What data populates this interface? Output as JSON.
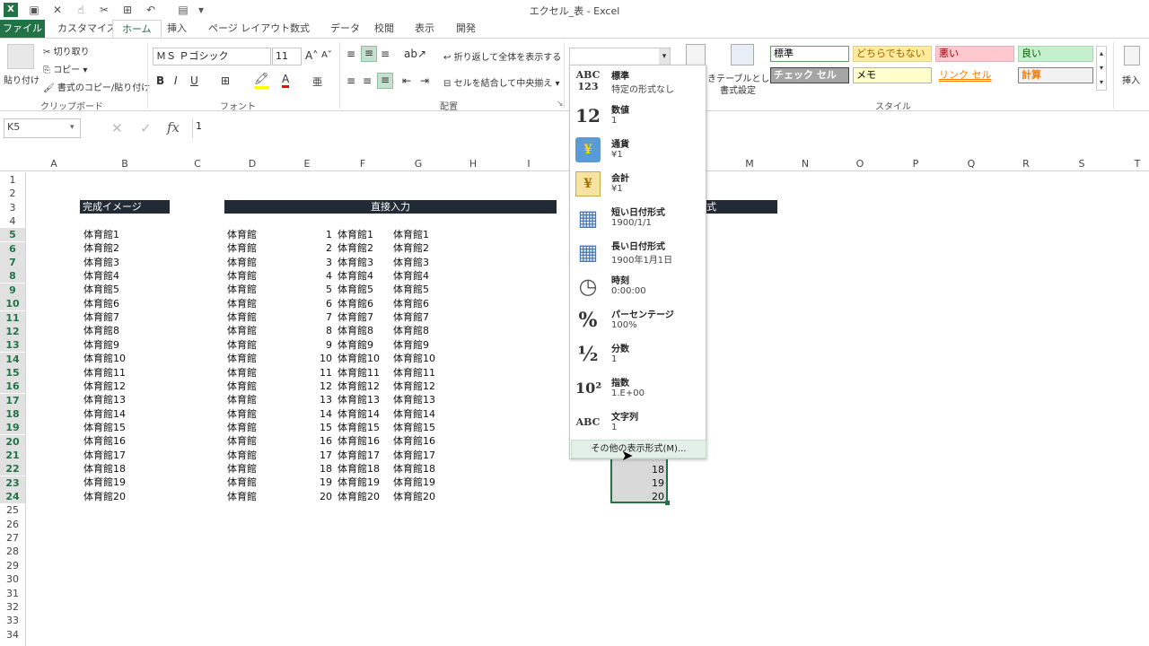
{
  "window": {
    "title": "エクセル_表 - Excel"
  },
  "tabs": [
    "ファイル",
    "カスタマイズ",
    "ホーム",
    "挿入",
    "ページ レイアウト",
    "数式",
    "データ",
    "校閲",
    "表示",
    "開発"
  ],
  "ribbon": {
    "clipboard": {
      "paste": "貼り付け",
      "cut": "切り取り",
      "copy": "コピー",
      "format_painter": "書式のコピー/貼り付け",
      "label": "クリップボード"
    },
    "font": {
      "name": "ＭＳ Ｐゴシック",
      "size": "11",
      "label": "フォント"
    },
    "alignment": {
      "wrap": "折り返して全体を表示する",
      "merge": "セルを結合して中央揃え",
      "label": "配置"
    },
    "number_format_value": "",
    "table_btn": {
      "left": "き",
      "text1": "テーブルとして",
      "text2": "書式設定"
    },
    "styles": {
      "label": "スタイル",
      "cells": [
        {
          "text": "標準",
          "bg": "#ffffff",
          "fg": "#000000",
          "border": "#6a9a6a"
        },
        {
          "text": "どちらでもない",
          "bg": "#ffeb9c",
          "fg": "#9c6500",
          "border": "#e0d090"
        },
        {
          "text": "悪い",
          "bg": "#ffc7ce",
          "fg": "#9c0006",
          "border": "#e8b0b8"
        },
        {
          "text": "良い",
          "bg": "#c6efce",
          "fg": "#006100",
          "border": "#a8d8b0"
        },
        {
          "text": "チェック セル",
          "bg": "#a5a5a5",
          "fg": "#ffffff",
          "border": "#3f3f3f"
        },
        {
          "text": "メモ",
          "bg": "#ffffcc",
          "fg": "#000000",
          "border": "#b2b2b2"
        },
        {
          "text": "リンク セル",
          "bg": "#ffffff",
          "fg": "#fa7d00",
          "border": "#ffffff"
        },
        {
          "text": "計算",
          "bg": "#f2f2f2",
          "fg": "#fa7d00",
          "border": "#7f7f7f"
        }
      ]
    },
    "insert": "挿入"
  },
  "formula_bar": {
    "name_box": "K5",
    "fx": "fx",
    "value": "1"
  },
  "columns": [
    "A",
    "B",
    "C",
    "D",
    "E",
    "F",
    "G",
    "H",
    "I",
    "J",
    "K",
    "L",
    "M",
    "N",
    "O",
    "P",
    "Q",
    "R",
    "S",
    "T"
  ],
  "rows": [
    "1",
    "2",
    "3",
    "4",
    "5",
    "6",
    "7",
    "8",
    "9",
    "10",
    "11",
    "12",
    "13",
    "14",
    "15",
    "16",
    "17",
    "18",
    "19",
    "20",
    "21",
    "22",
    "23",
    "24",
    "25",
    "26",
    "27",
    "28",
    "29",
    "30",
    "31",
    "32",
    "33",
    "34"
  ],
  "headers": {
    "b3": "完成イメージ",
    "d3": "直接入力",
    "k3_tail": "式"
  },
  "data_rows": [
    {
      "b": "体育館1",
      "d": "体育館",
      "e": "1",
      "f": "体育館1",
      "g": "体育館1"
    },
    {
      "b": "体育館2",
      "d": "体育館",
      "e": "2",
      "f": "体育館2",
      "g": "体育館2"
    },
    {
      "b": "体育館3",
      "d": "体育館",
      "e": "3",
      "f": "体育館3",
      "g": "体育館3"
    },
    {
      "b": "体育館4",
      "d": "体育館",
      "e": "4",
      "f": "体育館4",
      "g": "体育館4"
    },
    {
      "b": "体育館5",
      "d": "体育館",
      "e": "5",
      "f": "体育館5",
      "g": "体育館5"
    },
    {
      "b": "体育館6",
      "d": "体育館",
      "e": "6",
      "f": "体育館6",
      "g": "体育館6"
    },
    {
      "b": "体育館7",
      "d": "体育館",
      "e": "7",
      "f": "体育館7",
      "g": "体育館7"
    },
    {
      "b": "体育館8",
      "d": "体育館",
      "e": "8",
      "f": "体育館8",
      "g": "体育館8"
    },
    {
      "b": "体育館9",
      "d": "体育館",
      "e": "9",
      "f": "体育館9",
      "g": "体育館9"
    },
    {
      "b": "体育館10",
      "d": "体育館",
      "e": "10",
      "f": "体育館10",
      "g": "体育館10"
    },
    {
      "b": "体育館11",
      "d": "体育館",
      "e": "11",
      "f": "体育館11",
      "g": "体育館11"
    },
    {
      "b": "体育館12",
      "d": "体育館",
      "e": "12",
      "f": "体育館12",
      "g": "体育館12"
    },
    {
      "b": "体育館13",
      "d": "体育館",
      "e": "13",
      "f": "体育館13",
      "g": "体育館13"
    },
    {
      "b": "体育館14",
      "d": "体育館",
      "e": "14",
      "f": "体育館14",
      "g": "体育館14"
    },
    {
      "b": "体育館15",
      "d": "体育館",
      "e": "15",
      "f": "体育館15",
      "g": "体育館15"
    },
    {
      "b": "体育館16",
      "d": "体育館",
      "e": "16",
      "f": "体育館16",
      "g": "体育館16"
    },
    {
      "b": "体育館17",
      "d": "体育館",
      "e": "17",
      "f": "体育館17",
      "g": "体育館17"
    },
    {
      "b": "体育館18",
      "d": "体育館",
      "e": "18",
      "f": "体育館18",
      "g": "体育館18"
    },
    {
      "b": "体育館19",
      "d": "体育館",
      "e": "19",
      "f": "体育館19",
      "g": "体育館19"
    },
    {
      "b": "体育館20",
      "d": "体育館",
      "e": "20",
      "f": "体育館20",
      "g": "体育館20"
    }
  ],
  "k_visible": [
    "18",
    "19",
    "20"
  ],
  "number_format_menu": [
    {
      "icon": "ABC\n123",
      "name": "標準",
      "sample": "特定の形式なし"
    },
    {
      "icon": "12",
      "name": "数値",
      "sample": "1"
    },
    {
      "icon": "¥",
      "name": "通貨",
      "sample": "¥1"
    },
    {
      "icon": "¥",
      "name": "会計",
      "sample": " ¥1"
    },
    {
      "icon": "▦",
      "name": "短い日付形式",
      "sample": "1900/1/1"
    },
    {
      "icon": "▦",
      "name": "長い日付形式",
      "sample": "1900年1月1日"
    },
    {
      "icon": "◷",
      "name": "時刻",
      "sample": "0:00:00"
    },
    {
      "icon": "%",
      "name": "パーセンテージ",
      "sample": "100%"
    },
    {
      "icon": "½",
      "name": "分数",
      "sample": "1"
    },
    {
      "icon": "10²",
      "name": "指数",
      "sample": "1.E+00"
    },
    {
      "icon": "ABC",
      "name": "文字列",
      "sample": "1"
    }
  ],
  "more_formats": "その他の表示形式(M)...",
  "colors": {
    "excel_green": "#217346",
    "header_dark": "#222b35",
    "selection": "#d9d9d9"
  }
}
